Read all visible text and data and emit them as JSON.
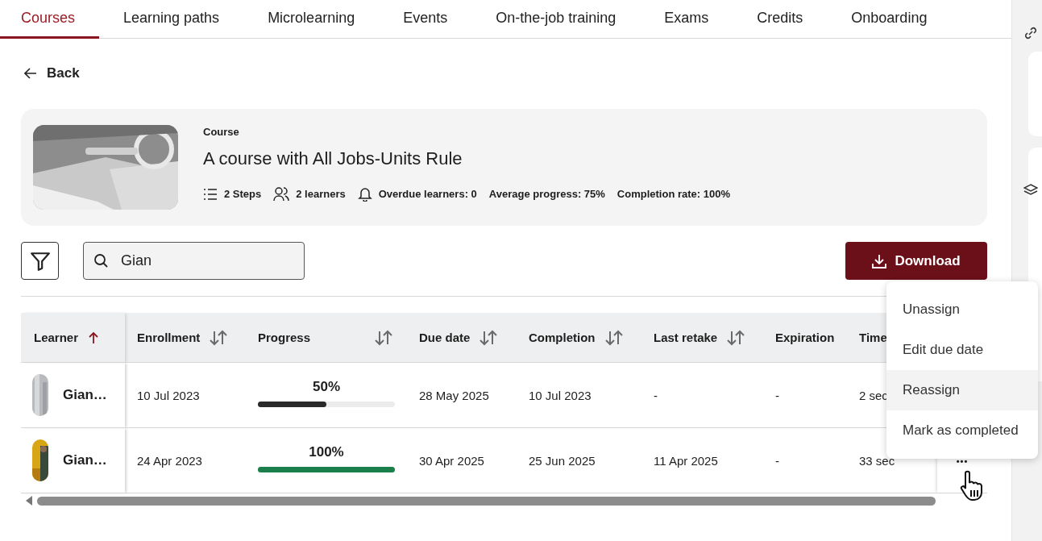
{
  "tabs": [
    {
      "label": "Courses",
      "selected": true
    },
    {
      "label": "Learning paths",
      "selected": false
    },
    {
      "label": "Microlearning",
      "selected": false
    },
    {
      "label": "Events",
      "selected": false
    },
    {
      "label": "On-the-job training",
      "selected": false
    },
    {
      "label": "Exams",
      "selected": false
    },
    {
      "label": "Credits",
      "selected": false
    },
    {
      "label": "Onboarding",
      "selected": false
    }
  ],
  "back": {
    "label": "Back"
  },
  "course": {
    "type": "Course",
    "title": "A course with All Jobs-Units Rule",
    "stats": [
      {
        "kind": "steps",
        "text": "2 Steps"
      },
      {
        "kind": "learners",
        "text": "2 learners"
      },
      {
        "kind": "overdue",
        "text": "Overdue learners: 0"
      },
      {
        "kind": "plain",
        "text": "Average progress: 75%"
      },
      {
        "kind": "plain",
        "text": "Completion rate: 100%"
      }
    ]
  },
  "search": {
    "value": "Gian"
  },
  "download": {
    "label": "Download"
  },
  "table": {
    "columns": [
      {
        "label": "Learner",
        "sortable": true,
        "sorted": true
      },
      {
        "label": "Enrollment",
        "sortable": true,
        "sorted": false
      },
      {
        "label": "Progress",
        "sortable": true,
        "sorted": false
      },
      {
        "label": "Due date",
        "sortable": true,
        "sorted": false
      },
      {
        "label": "Completion",
        "sortable": true,
        "sorted": false
      },
      {
        "label": "Last retake",
        "sortable": true,
        "sorted": false
      },
      {
        "label": "Expiration"
      },
      {
        "label": "Time"
      }
    ],
    "rows": [
      {
        "learner": "Gian…",
        "enrollment": "10 Jul 2023",
        "progress": {
          "label": "50%",
          "level": 0.5,
          "color": "#2a2a2a"
        },
        "due_date": "28 May 2025",
        "completion": "10 Jul 2023",
        "last_retake": "-",
        "expiration": "-",
        "time": "2 sec"
      },
      {
        "learner": "Gian…",
        "enrollment": "24 Apr 2023",
        "progress": {
          "label": "100%",
          "level": 1,
          "color": "#1a7f4b"
        },
        "due_date": "30 Apr 2025",
        "completion": "25 Jun 2025",
        "last_retake": "11 Apr 2025",
        "expiration": "-",
        "time": "33 sec",
        "actions": "•••"
      }
    ]
  },
  "menu": {
    "items": [
      {
        "label": "Unassign",
        "selected": false
      },
      {
        "label": "Edit due date",
        "selected": false
      },
      {
        "label": "Reassign",
        "selected": true
      },
      {
        "label": "Mark as completed",
        "selected": false
      }
    ]
  }
}
